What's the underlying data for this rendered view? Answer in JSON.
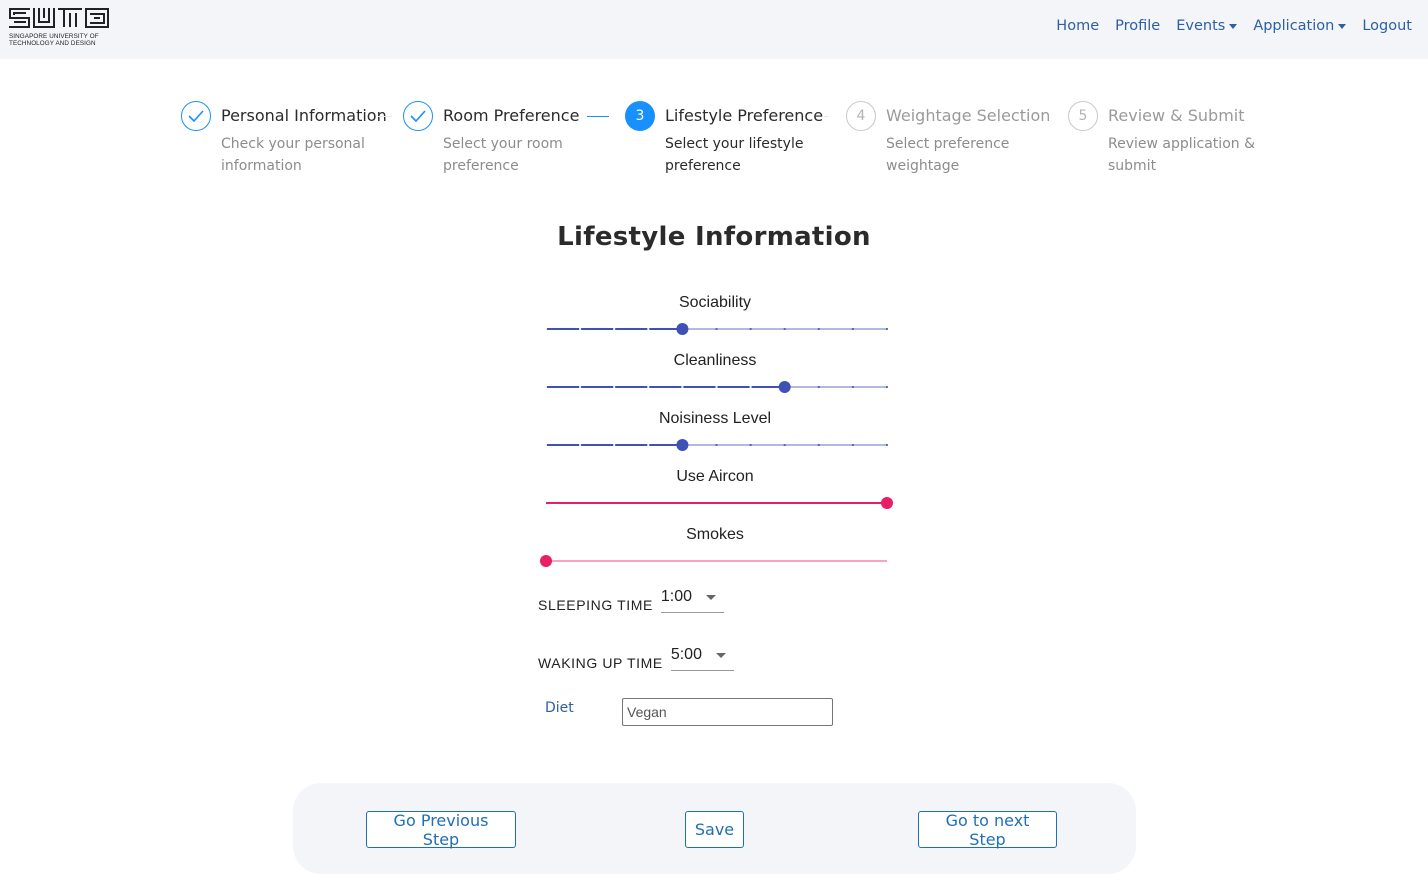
{
  "header": {
    "logo_text": "SUTD",
    "logo_subtitle_line1": "SINGAPORE UNIVERSITY OF",
    "logo_subtitle_line2": "TECHNOLOGY AND DESIGN",
    "nav": [
      {
        "label": "Home",
        "dropdown": false
      },
      {
        "label": "Profile",
        "dropdown": false
      },
      {
        "label": "Events",
        "dropdown": true
      },
      {
        "label": "Application",
        "dropdown": true
      },
      {
        "label": "Logout",
        "dropdown": false
      }
    ]
  },
  "stepper": {
    "current": 3,
    "steps": [
      {
        "number": "1",
        "title": "Personal Information",
        "description": "Check your personal information",
        "status": "finished"
      },
      {
        "number": "2",
        "title": "Room Preference",
        "description": "Select your room preference",
        "status": "finished"
      },
      {
        "number": "3",
        "title": "Lifestyle Preference",
        "description": "Select your lifestyle preference",
        "status": "active"
      },
      {
        "number": "4",
        "title": "Weightage Selection",
        "description": "Select preference weightage",
        "status": "waiting"
      },
      {
        "number": "5",
        "title": "Review & Submit",
        "description": "Review application & submit",
        "status": "waiting"
      }
    ]
  },
  "form": {
    "title": "Lifestyle Information",
    "sliders": [
      {
        "label": "Sociability",
        "value": 4,
        "min": 0,
        "max": 10,
        "step": 1,
        "color": "#3f51b5",
        "ticks": true
      },
      {
        "label": "Cleanliness",
        "value": 7,
        "min": 0,
        "max": 10,
        "step": 1,
        "color": "#3f51b5",
        "ticks": true
      },
      {
        "label": "Noisiness Level",
        "value": 4,
        "min": 0,
        "max": 10,
        "step": 1,
        "color": "#3f51b5",
        "ticks": true
      },
      {
        "label": "Use Aircon",
        "value": 1,
        "min": 0,
        "max": 1,
        "step": 1,
        "color": "#e91e63",
        "ticks": false
      },
      {
        "label": "Smokes",
        "value": 0,
        "min": 0,
        "max": 1,
        "step": 1,
        "color": "#e91e63",
        "ticks": false
      }
    ],
    "sleeping_time": {
      "label": "SLEEPING TIME",
      "value": "1:00"
    },
    "waking_time": {
      "label": "WAKING UP TIME",
      "value": "5:00"
    },
    "diet": {
      "label": "Diet",
      "value": "Vegan"
    }
  },
  "actions": {
    "previous": "Go Previous Step",
    "save": "Save",
    "next": "Go to next Step"
  },
  "colors": {
    "primary": "#1890ff",
    "link": "#2d5fa3",
    "slider_primary": "#3f51b5",
    "slider_secondary": "#e91e63",
    "navbar_bg": "#f3f5f8"
  }
}
